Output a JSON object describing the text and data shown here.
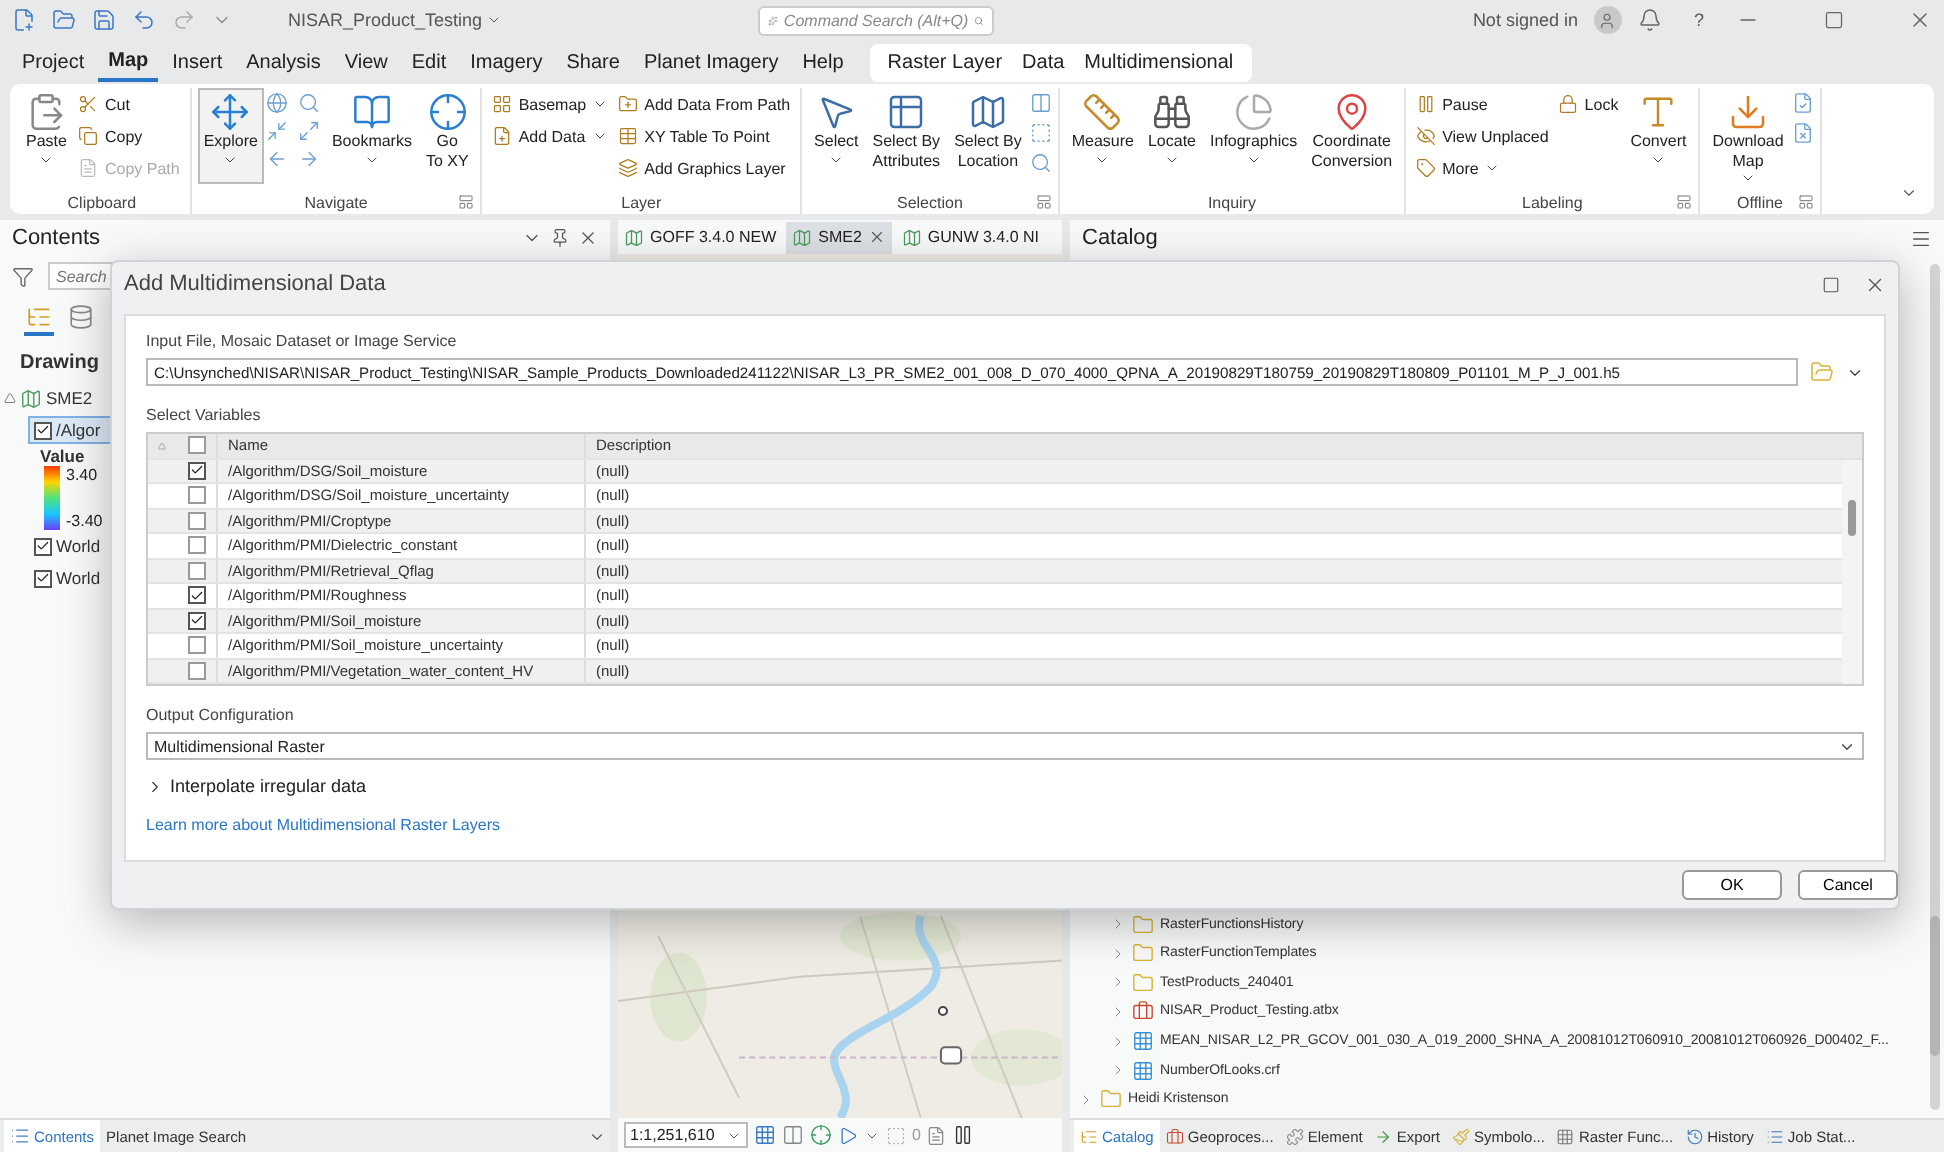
{
  "title_bar": {
    "document": "NISAR_Product_Testing",
    "search_placeholder": "Command Search (Alt+Q)",
    "account": "Not signed in",
    "help": "?"
  },
  "menu_tabs": [
    {
      "label": "Project",
      "selected": false
    },
    {
      "label": "Map",
      "selected": true
    },
    {
      "label": "Insert",
      "selected": false
    },
    {
      "label": "Analysis",
      "selected": false
    },
    {
      "label": "View",
      "selected": false
    },
    {
      "label": "Edit",
      "selected": false
    },
    {
      "label": "Imagery",
      "selected": false
    },
    {
      "label": "Share",
      "selected": false
    },
    {
      "label": "Planet Imagery",
      "selected": false
    },
    {
      "label": "Help",
      "selected": false
    }
  ],
  "contextual_tabs": [
    {
      "label": "Raster Layer",
      "selected": false
    },
    {
      "label": "Data",
      "selected": false
    },
    {
      "label": "Multidimensional",
      "selected": false
    }
  ],
  "ribbon": [
    {
      "label": "Clipboard",
      "launcher": false,
      "items": [
        {
          "kind": "large",
          "label": "Paste",
          "caret": true,
          "disabled": false,
          "selected": false
        },
        {
          "kind": "stack",
          "entries": [
            {
              "label": "Cut",
              "caret": false,
              "disabled": false
            },
            {
              "label": "Copy",
              "caret": false,
              "disabled": false
            },
            {
              "label": "Copy Path",
              "caret": false,
              "disabled": true
            }
          ]
        }
      ]
    },
    {
      "label": "Navigate",
      "launcher": true,
      "items": [
        {
          "kind": "large",
          "label": "Explore",
          "caret": true,
          "disabled": false,
          "selected": true
        },
        {
          "kind": "icons"
        },
        {
          "kind": "large",
          "label": "Bookmarks",
          "caret": true,
          "disabled": false,
          "selected": false
        },
        {
          "kind": "large",
          "label": "Go\nTo XY",
          "caret": false,
          "disabled": false,
          "selected": false
        }
      ]
    },
    {
      "label": "Layer",
      "launcher": false,
      "items": [
        {
          "kind": "stack",
          "entries": [
            {
              "label": "Basemap",
              "caret": true,
              "disabled": false
            },
            {
              "label": "Add Data",
              "caret": true,
              "disabled": false
            }
          ]
        },
        {
          "kind": "stack",
          "entries": [
            {
              "label": "Add Data From Path",
              "caret": false,
              "disabled": false
            },
            {
              "label": "XY Table To Point",
              "caret": false,
              "disabled": false
            },
            {
              "label": "Add Graphics Layer",
              "caret": false,
              "disabled": false
            }
          ]
        }
      ]
    },
    {
      "label": "Selection",
      "launcher": true,
      "items": [
        {
          "kind": "large",
          "label": "Select",
          "caret": true,
          "disabled": false,
          "selected": false
        },
        {
          "kind": "large",
          "label": "Select By\nAttributes",
          "caret": false,
          "disabled": false,
          "selected": false
        },
        {
          "kind": "large",
          "label": "Select By\nLocation",
          "caret": false,
          "disabled": false,
          "selected": false
        },
        {
          "kind": "icons"
        }
      ]
    },
    {
      "label": "Inquiry",
      "launcher": false,
      "items": [
        {
          "kind": "large",
          "label": "Measure",
          "caret": true,
          "disabled": false,
          "selected": false
        },
        {
          "kind": "large",
          "label": "Locate",
          "caret": true,
          "disabled": false,
          "selected": false
        },
        {
          "kind": "large",
          "label": "Infographics",
          "caret": true,
          "disabled": false,
          "selected": false
        },
        {
          "kind": "large",
          "label": "Coordinate\nConversion",
          "caret": false,
          "disabled": false,
          "selected": false
        }
      ]
    },
    {
      "label": "Labeling",
      "launcher": true,
      "items": [
        {
          "kind": "stack",
          "entries": [
            {
              "label": "Pause",
              "caret": false,
              "disabled": false
            },
            {
              "label": "View Unplaced",
              "caret": false,
              "disabled": false
            },
            {
              "label": "More",
              "caret": true,
              "disabled": false
            }
          ]
        },
        {
          "kind": "stack",
          "entries": [
            {
              "label": "Lock",
              "caret": false,
              "disabled": false
            }
          ]
        },
        {
          "kind": "large",
          "label": "Convert",
          "caret": true,
          "disabled": false,
          "selected": false
        }
      ]
    },
    {
      "label": "Offline",
      "launcher": true,
      "items": [
        {
          "kind": "large",
          "label": "Download\nMap",
          "caret": true,
          "disabled": false,
          "selected": false
        },
        {
          "kind": "icons"
        }
      ]
    }
  ],
  "contents": {
    "title": "Contents",
    "search_placeholder": "Search",
    "heading": "Drawing",
    "tree": [
      {
        "kind": "group",
        "label": "SME2",
        "expanded": true,
        "children": [
          {
            "kind": "layer",
            "label": "/Algor",
            "checked": true,
            "selected": true,
            "legend": {
              "title": "Value",
              "high": "3.40",
              "low": "-3.40"
            }
          },
          {
            "kind": "layer",
            "label": "World",
            "checked": true,
            "selected": false
          },
          {
            "kind": "layer",
            "label": "World",
            "checked": true,
            "selected": false
          }
        ]
      }
    ],
    "bottom_tabs": [
      {
        "label": "Contents",
        "selected": true
      },
      {
        "label": "Planet Image Search",
        "selected": false
      }
    ]
  },
  "map_view": {
    "tabs": [
      {
        "label": "GOFF 3.4.0 NEW",
        "selected": false
      },
      {
        "label": "SME2",
        "selected": true
      },
      {
        "label": "GUNW 3.4.0 NI",
        "selected": false
      }
    ],
    "scale": "1:1,251,610",
    "selection_count": "0"
  },
  "catalog": {
    "title": "Catalog",
    "tree": [
      {
        "children": [
          {
            "kind": "folder",
            "label": "RasterFunctionsHistory"
          },
          {
            "kind": "folder",
            "label": "RasterFunctionTemplates"
          },
          {
            "kind": "folder",
            "label": "TestProducts_240401"
          },
          {
            "kind": "toolbox",
            "label": "NISAR_Product_Testing.atbx"
          },
          {
            "kind": "raster",
            "label": "MEAN_NISAR_L2_PR_GCOV_001_030_A_019_2000_SHNA_A_20081012T060910_20081012T060926_D00402_F..."
          },
          {
            "kind": "raster",
            "label": "NumberOfLooks.crf"
          }
        ]
      },
      {
        "kind": "folder",
        "label": "Heidi Kristenson"
      }
    ],
    "bottom_tabs": [
      {
        "label": "Catalog",
        "selected": true
      },
      {
        "label": "Geoproces...",
        "selected": false
      },
      {
        "label": "Element",
        "selected": false
      },
      {
        "label": "Export",
        "selected": false
      },
      {
        "label": "Symbolo...",
        "selected": false
      },
      {
        "label": "Raster Func...",
        "selected": false
      },
      {
        "label": "History",
        "selected": false
      },
      {
        "label": "Job Stat...",
        "selected": false
      }
    ]
  },
  "dialog": {
    "title": "Add Multidimensional Data",
    "input_label": "Input File, Mosaic Dataset or Image Service",
    "input_value": "C:\\Unsynched\\NISAR\\NISAR_Product_Testing\\NISAR_Sample_Products_Downloaded241122\\NISAR_L3_PR_SME2_001_008_D_070_4000_QPNA_A_20190829T180759_20190829T180809_P01101_M_P_J_001.h5",
    "variables_label": "Select Variables",
    "columns": [
      "Name",
      "Description"
    ],
    "all_checked": false,
    "rows": [
      {
        "name": "/Algorithm/DSG/Soil_moisture",
        "description": "(null)",
        "checked": true
      },
      {
        "name": "/Algorithm/DSG/Soil_moisture_uncertainty",
        "description": "(null)",
        "checked": false
      },
      {
        "name": "/Algorithm/PMI/Croptype",
        "description": "(null)",
        "checked": false
      },
      {
        "name": "/Algorithm/PMI/Dielectric_constant",
        "description": "(null)",
        "checked": false
      },
      {
        "name": "/Algorithm/PMI/Retrieval_Qflag",
        "description": "(null)",
        "checked": false
      },
      {
        "name": "/Algorithm/PMI/Roughness",
        "description": "(null)",
        "checked": true
      },
      {
        "name": "/Algorithm/PMI/Soil_moisture",
        "description": "(null)",
        "checked": true
      },
      {
        "name": "/Algorithm/PMI/Soil_moisture_uncertainty",
        "description": "(null)",
        "checked": false
      },
      {
        "name": "/Algorithm/PMI/Vegetation_water_content_HV",
        "description": "(null)",
        "checked": false
      }
    ],
    "output_label": "Output Configuration",
    "output_value": "Multidimensional Raster",
    "interpolate": {
      "label": "Interpolate irregular data",
      "expanded": false
    },
    "link": "Learn more about Multidimensional Raster Layers",
    "buttons": [
      "OK",
      "Cancel"
    ]
  }
}
